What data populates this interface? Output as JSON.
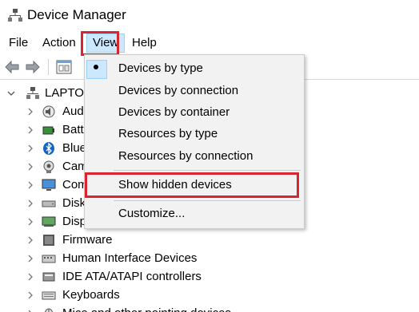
{
  "window": {
    "title": "Device Manager"
  },
  "menubar": {
    "file": "File",
    "action": "Action",
    "view": "View",
    "help": "Help"
  },
  "tree": {
    "root": "LAPTOP-",
    "items": [
      "Aud",
      "Batt",
      "Blue",
      "Cam",
      "Com",
      "Disk",
      "Disp",
      "Firmware",
      "Human Interface Devices",
      "IDE ATA/ATAPI controllers",
      "Keyboards",
      "Mice and other pointing devices"
    ]
  },
  "view_menu": {
    "items": [
      {
        "label": "Devices by type",
        "checked": true
      },
      {
        "label": "Devices by connection"
      },
      {
        "label": "Devices by container"
      },
      {
        "label": "Resources by type"
      },
      {
        "label": "Resources by connection"
      },
      {
        "label": "Show hidden devices"
      },
      {
        "label": "Customize..."
      }
    ]
  },
  "colors": {
    "highlight_border": "#d9252f",
    "menu_hover": "#cce8ff",
    "menu_bg": "#f2f2f2"
  }
}
